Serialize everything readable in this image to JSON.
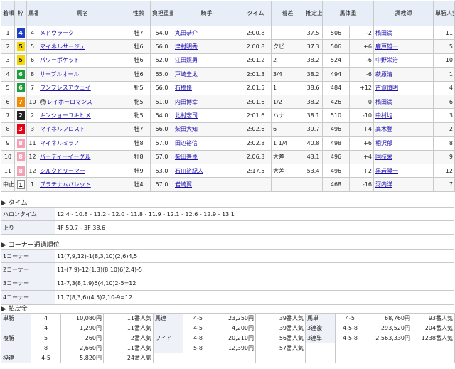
{
  "result": {
    "headers": [
      "着順",
      "枠",
      "馬番",
      "馬名",
      "性齢",
      "負担重量",
      "騎手",
      "タイム",
      "着差",
      "推定上り",
      "馬体重",
      "",
      "調教師",
      "単勝人気"
    ],
    "rows": [
      {
        "rank": "1",
        "waku": "4",
        "uma": "4",
        "name": "メドウラーク",
        "sex": "牡7",
        "kg": "54.0",
        "jockey": "丸田恭介",
        "time": "2:00.8",
        "diff": "",
        "agari": "37.5",
        "weight": "506",
        "chg": "-2",
        "trainer": "橋田満",
        "pop": "11"
      },
      {
        "rank": "2",
        "waku": "5",
        "uma": "5",
        "name": "マイネルサージュ",
        "sex": "牡6",
        "kg": "56.0",
        "jockey": "津村明秀",
        "time": "2:00.8",
        "diff": "クビ",
        "agari": "37.3",
        "weight": "506",
        "chg": "+6",
        "trainer": "鹿戸雄一",
        "pop": "5"
      },
      {
        "rank": "3",
        "waku": "5",
        "uma": "6",
        "name": "パワーポケット",
        "sex": "牡6",
        "kg": "52.0",
        "jockey": "江田照男",
        "time": "2:01.2",
        "diff": "2",
        "agari": "38.2",
        "weight": "524",
        "chg": "-6",
        "trainer": "中野栄治",
        "pop": "10"
      },
      {
        "rank": "4",
        "waku": "6",
        "uma": "8",
        "name": "サーブルオール",
        "sex": "牡6",
        "kg": "55.0",
        "jockey": "戸崎圭太",
        "time": "2:01.3",
        "diff": "3/4",
        "agari": "38.2",
        "weight": "494",
        "chg": "-6",
        "trainer": "萩原清",
        "pop": "1"
      },
      {
        "rank": "5",
        "waku": "6",
        "uma": "7",
        "name": "ワンブレスアウェイ",
        "sex": "牝5",
        "kg": "56.0",
        "jockey": "石橋脩",
        "time": "2:01.5",
        "diff": "1",
        "agari": "38.6",
        "weight": "484",
        "chg": "+12",
        "trainer": "古賀慎明",
        "pop": "4"
      },
      {
        "rank": "6",
        "waku": "7",
        "uma": "10",
        "name": "レイホーロマンス",
        "mark": "地",
        "sex": "牝5",
        "kg": "51.0",
        "jockey": "内田博幸",
        "time": "2:01.6",
        "diff": "1/2",
        "agari": "38.2",
        "weight": "426",
        "chg": "0",
        "trainer": "橋田満",
        "pop": "6"
      },
      {
        "rank": "7",
        "waku": "2",
        "uma": "2",
        "name": "キンショーユキヒメ",
        "sex": "牝5",
        "kg": "54.0",
        "jockey": "北村宏司",
        "time": "2:01.6",
        "diff": "ハナ",
        "agari": "38.1",
        "weight": "510",
        "chg": "-10",
        "trainer": "中村均",
        "pop": "3"
      },
      {
        "rank": "8",
        "waku": "3",
        "uma": "3",
        "name": "マイネルフロスト",
        "sex": "牡7",
        "kg": "56.0",
        "jockey": "柴田大知",
        "time": "2:02.6",
        "diff": "6",
        "agari": "39.7",
        "weight": "496",
        "chg": "+4",
        "trainer": "高木登",
        "pop": "2"
      },
      {
        "rank": "9",
        "waku": "8",
        "uma": "11",
        "name": "マイネルミラノ",
        "sex": "牡8",
        "kg": "57.0",
        "jockey": "田辺裕信",
        "time": "2:02.8",
        "diff": "1 1/4",
        "agari": "40.8",
        "weight": "498",
        "chg": "+6",
        "trainer": "相沢郁",
        "pop": "8"
      },
      {
        "rank": "10",
        "waku": "8",
        "uma": "12",
        "name": "バーディーイーグル",
        "sex": "牡8",
        "kg": "57.0",
        "jockey": "柴田善臣",
        "time": "2:06.3",
        "diff": "大差",
        "agari": "43.1",
        "weight": "496",
        "chg": "+4",
        "trainer": "国枝栄",
        "pop": "9"
      },
      {
        "rank": "11",
        "waku": "8",
        "uma": "12",
        "name": "シルクドリーマー",
        "sex": "牡9",
        "kg": "53.0",
        "jockey": "石川裕紀人",
        "time": "2:17.5",
        "diff": "大差",
        "agari": "53.4",
        "weight": "496",
        "chg": "+2",
        "trainer": "黒岩陽一",
        "pop": "12"
      },
      {
        "rank": "中止",
        "waku": "1",
        "uma": "1",
        "name": "プラチナムバレット",
        "sex": "牡4",
        "kg": "57.0",
        "jockey": "岩崎翼",
        "time": "",
        "diff": "",
        "agari": "",
        "weight": "468",
        "chg": "-16",
        "trainer": "河内洋",
        "pop": "7"
      }
    ]
  },
  "laps": {
    "section_title": "タイム",
    "rows": [
      {
        "label": "ハロンタイム",
        "value": "12.4 - 10.8 - 11.2 - 12.0 - 11.8 - 11.9 - 12.1 - 12.6 - 12.9 - 13.1"
      },
      {
        "label": "上り",
        "value": "4F 50.7 - 3F 38.6"
      }
    ]
  },
  "corners": {
    "section_title": "コーナー通過順位",
    "rows": [
      {
        "label": "1コーナー",
        "value": "11(7,9,12)-1(8,3,10)(2,6)4,5"
      },
      {
        "label": "2コーナー",
        "value": "11-(7,9)-12(1,3)(8,10)6(2,4)-5"
      },
      {
        "label": "3コーナー",
        "value": "11-7,3(8,1,9)6(4,10)2-5=12"
      },
      {
        "label": "4コーナー",
        "value": "11,7(8,3,6)(4,5)2,10-9=12"
      }
    ]
  },
  "payout": {
    "section_title": "払戻金",
    "left": [
      {
        "label": "単勝",
        "lines": [
          {
            "num": "4",
            "yen": "10,080円",
            "pop": "11番人気"
          }
        ]
      },
      {
        "label": "複勝",
        "lines": [
          {
            "num": "4",
            "yen": "1,290円",
            "pop": "11番人気"
          },
          {
            "num": "5",
            "yen": "260円",
            "pop": "2番人気"
          },
          {
            "num": "8",
            "yen": "2,660円",
            "pop": "11番人気"
          }
        ]
      },
      {
        "label": "枠連",
        "lines": [
          {
            "num": "4-5",
            "yen": "5,820円",
            "pop": "24番人気"
          }
        ]
      }
    ],
    "mid": [
      {
        "label": "馬連",
        "lines": [
          {
            "num": "4-5",
            "yen": "23,250円",
            "pop": "39番人気"
          }
        ]
      },
      {
        "label": "ワイド",
        "lines": [
          {
            "num": "4-5",
            "yen": "4,200円",
            "pop": "39番人気"
          },
          {
            "num": "4-8",
            "yen": "20,210円",
            "pop": "56番人気"
          },
          {
            "num": "5-8",
            "yen": "12,390円",
            "pop": "57番人気"
          }
        ]
      }
    ],
    "right": [
      {
        "label": "馬単",
        "lines": [
          {
            "num": "4-5",
            "yen": "68,760円",
            "pop": "93番人気"
          }
        ]
      },
      {
        "label": "3連複",
        "lines": [
          {
            "num": "4-5-8",
            "yen": "293,520円",
            "pop": "204番人気"
          }
        ]
      },
      {
        "label": "3連単",
        "lines": [
          {
            "num": "4-5-8",
            "yen": "2,563,330円",
            "pop": "1238番人気"
          }
        ]
      }
    ]
  },
  "colors": {
    "waku": {
      "1": "#ffffff",
      "2": "#222222",
      "3": "#e60012",
      "4": "#1e40c8",
      "5": "#f4d600",
      "6": "#1a9e3a",
      "7": "#f08a00",
      "8": "#f4a0b4"
    },
    "header_bg": "#e8eef7",
    "link": "#1a0dab"
  }
}
